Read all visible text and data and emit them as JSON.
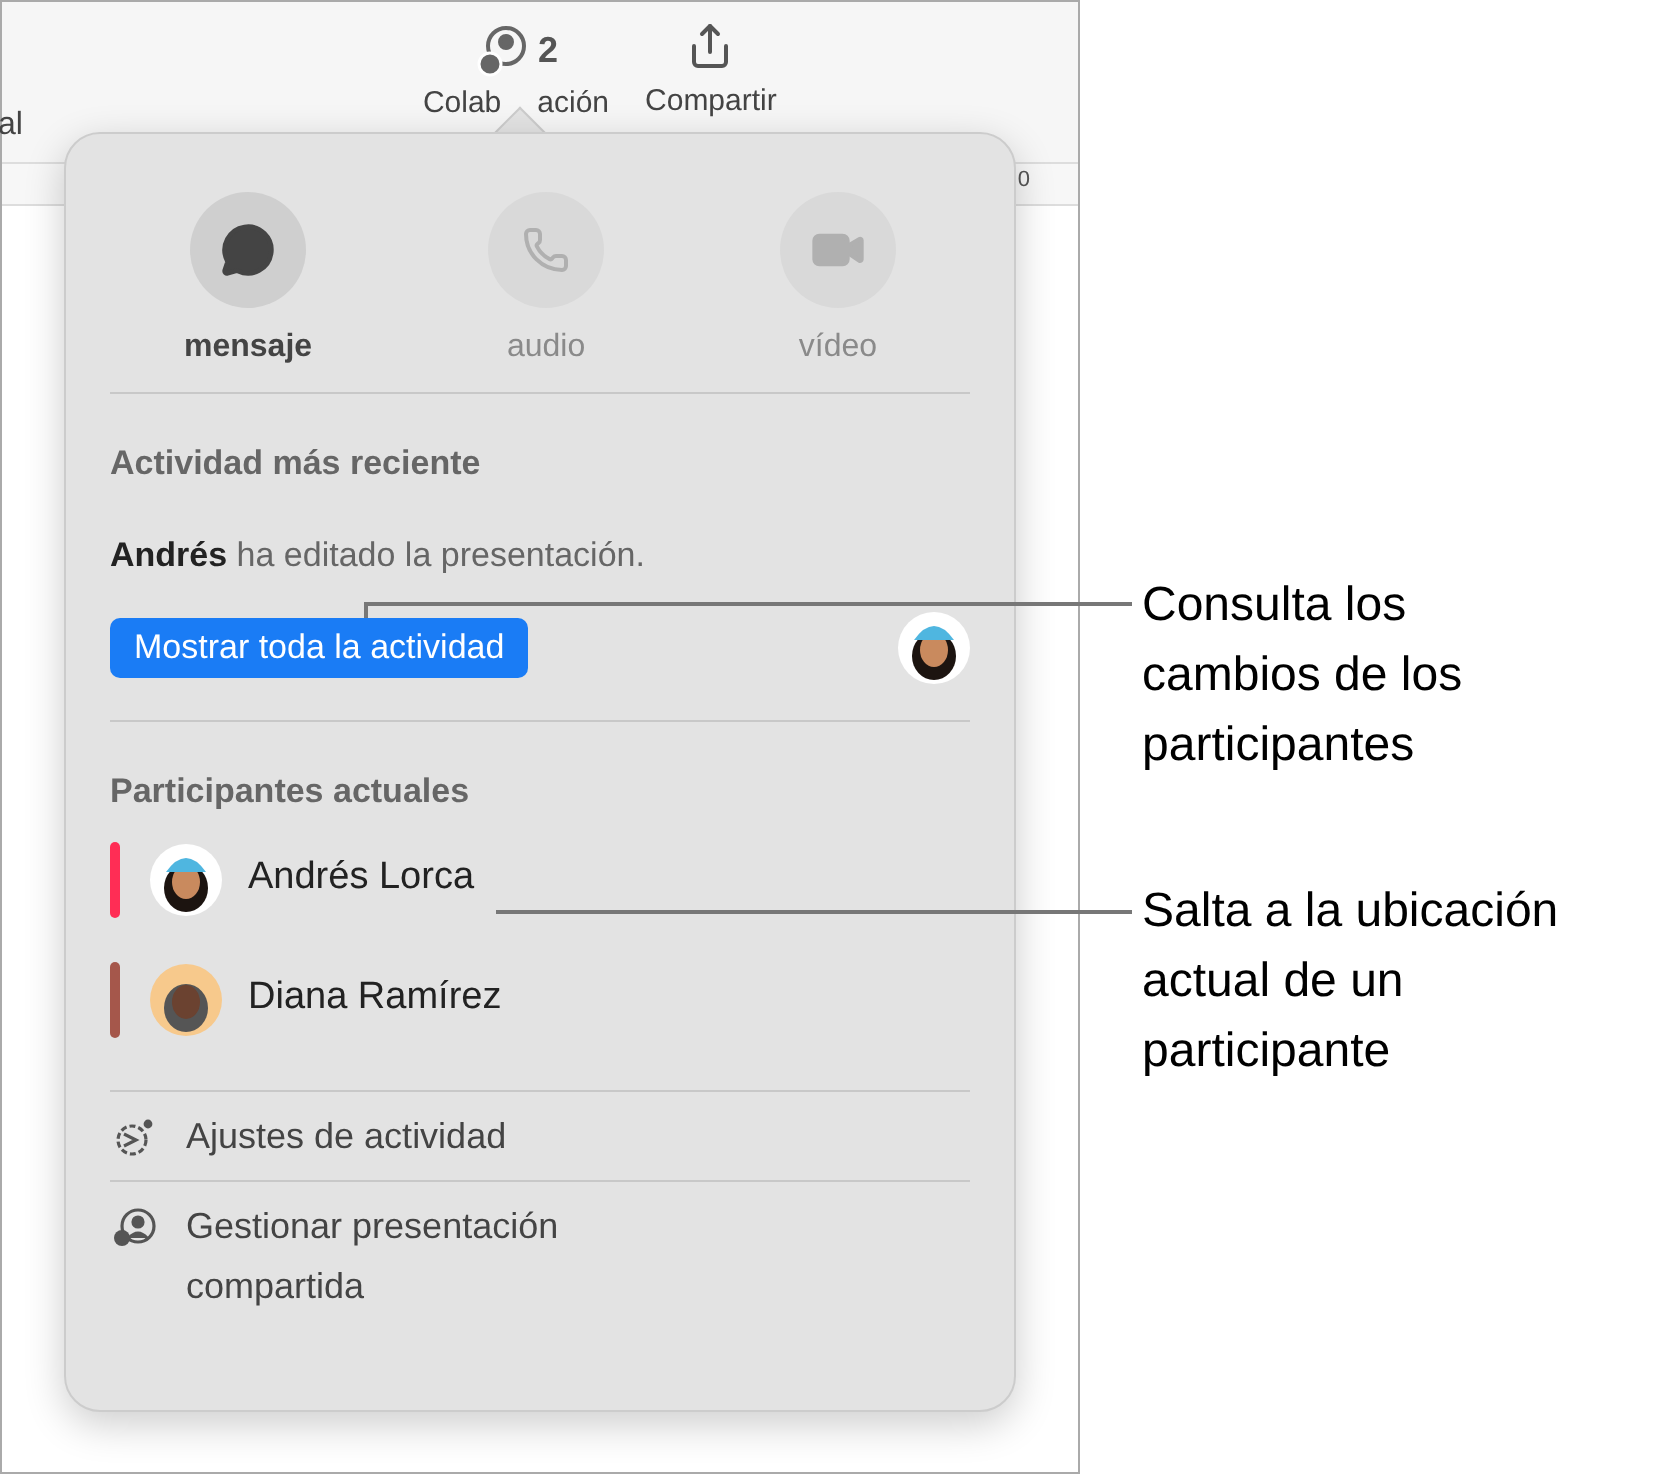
{
  "toolbar": {
    "left_label": "al",
    "collab_count": "2",
    "collab_label_parts": [
      "Colab",
      "ación"
    ],
    "share_label": "Compartir",
    "ruler_mark": "0"
  },
  "popover": {
    "actions": [
      {
        "kind": "message",
        "label": "mensaje",
        "disabled": false
      },
      {
        "kind": "audio",
        "label": "audio",
        "disabled": true
      },
      {
        "kind": "video",
        "label": "vídeo",
        "disabled": true
      }
    ],
    "recent": {
      "title": "Actividad más reciente",
      "text": "**Andrés** ha editado la presentación.",
      "button": "Mostrar toda la actividad"
    },
    "participants": {
      "title": "Participantes actuales",
      "items": [
        {
          "name": "Andrés Lorca",
          "color": "#ff2d55"
        },
        {
          "name": "Diana Ramírez",
          "color": "#a5574b"
        }
      ]
    },
    "menu": [
      {
        "kind": "settings",
        "label": "Ajustes de actividad"
      },
      {
        "kind": "manage",
        "label": "Gestionar presentación compartida"
      }
    ]
  },
  "callouts": [
    "Consulta los cambios de los participantes",
    "Salta a la ubicación actual de un participante"
  ]
}
